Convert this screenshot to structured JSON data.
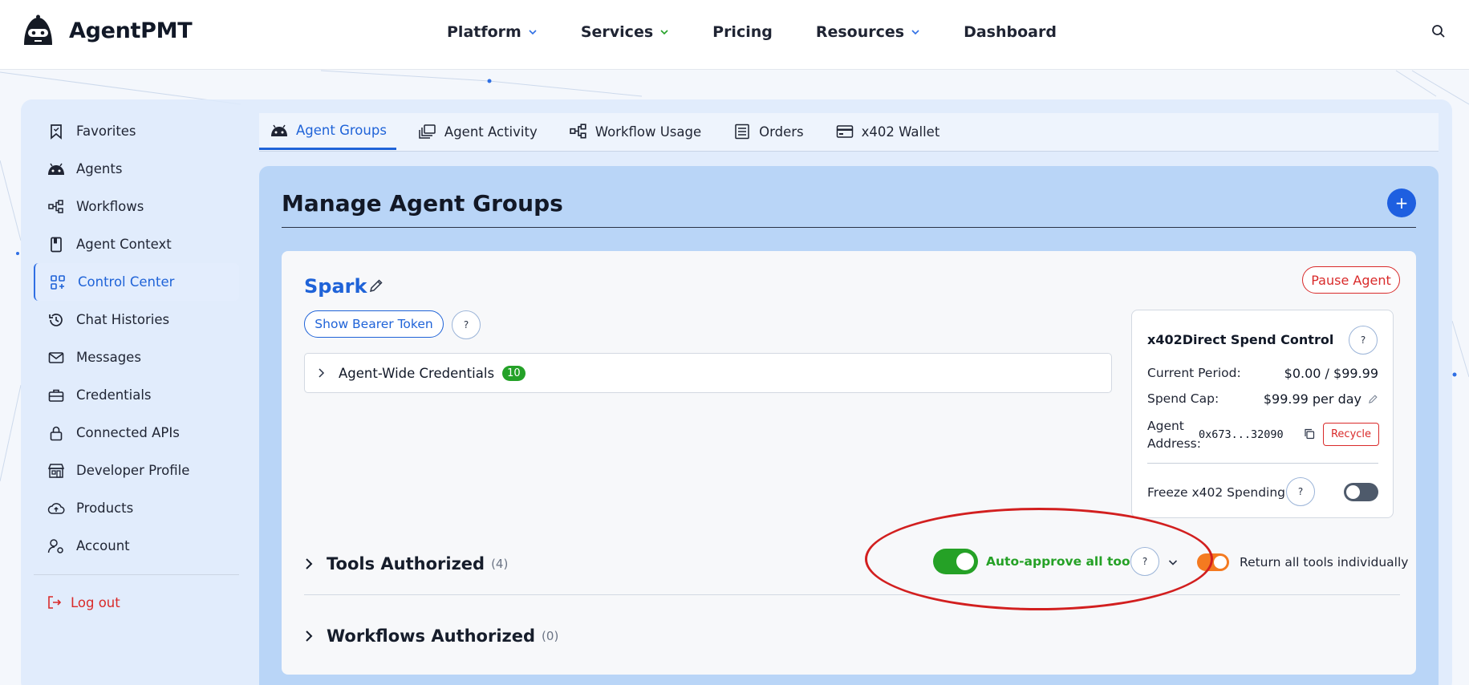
{
  "brand": {
    "name": "AgentPMT"
  },
  "nav": {
    "items": [
      {
        "label": "Platform",
        "has_dropdown": true,
        "chevron_color": "#2f6fe4"
      },
      {
        "label": "Services",
        "has_dropdown": true,
        "chevron_color": "#24a128"
      },
      {
        "label": "Pricing",
        "has_dropdown": false
      },
      {
        "label": "Resources",
        "has_dropdown": true,
        "chevron_color": "#2f6fe4"
      },
      {
        "label": "Dashboard",
        "has_dropdown": false
      }
    ],
    "search_icon": "search-icon"
  },
  "sidebar": {
    "items": [
      {
        "label": "Favorites",
        "icon": "bookmark-icon"
      },
      {
        "label": "Agents",
        "icon": "robot-icon"
      },
      {
        "label": "Workflows",
        "icon": "workflow-icon"
      },
      {
        "label": "Agent Context",
        "icon": "book-icon"
      },
      {
        "label": "Control Center",
        "icon": "grid-icon",
        "active": true
      },
      {
        "label": "Chat Histories",
        "icon": "history-icon"
      },
      {
        "label": "Messages",
        "icon": "mail-icon"
      },
      {
        "label": "Credentials",
        "icon": "briefcase-icon"
      },
      {
        "label": "Connected APIs",
        "icon": "lock-icon"
      },
      {
        "label": "Developer Profile",
        "icon": "store-icon"
      },
      {
        "label": "Products",
        "icon": "cloud-upload-icon"
      },
      {
        "label": "Account",
        "icon": "user-gear-icon"
      }
    ],
    "logout_label": "Log out"
  },
  "tabs": [
    {
      "label": "Agent Groups",
      "icon": "robot-icon",
      "active": true
    },
    {
      "label": "Agent Activity",
      "icon": "stack-icon"
    },
    {
      "label": "Workflow Usage",
      "icon": "workflow-icon"
    },
    {
      "label": "Orders",
      "icon": "receipt-icon"
    },
    {
      "label": "x402 Wallet",
      "icon": "card-icon"
    }
  ],
  "panel": {
    "title": "Manage Agent Groups",
    "add_label": "+"
  },
  "agent": {
    "name": "Spark",
    "pause_label": "Pause Agent",
    "bearer_label": "Show Bearer Token",
    "help_label": "?",
    "credentials": {
      "label": "Agent-Wide Credentials",
      "count": "10"
    }
  },
  "spend": {
    "title": "x402Direct Spend Control",
    "current_period_label": "Current Period:",
    "current_period_value": "$0.00 / $99.99",
    "cap_label": "Spend Cap:",
    "cap_value": "$99.99 per day",
    "address_label_1": "Agent",
    "address_label_2": "Address:",
    "address_value": "0x673...32090",
    "recycle_label": "Recycle",
    "freeze_label": "Freeze x402 Spending",
    "freeze_on": false
  },
  "tools": {
    "title": "Tools Authorized",
    "count": "(4)",
    "auto_label": "Auto-approve all tools",
    "auto_on": true,
    "return_label": "Return all tools individually",
    "return_on": true
  },
  "workflows": {
    "title": "Workflows Authorized",
    "count": "(0)"
  },
  "colors": {
    "primary": "#1f63d8",
    "danger": "#d92a2a",
    "success": "#24a128",
    "orange": "#f47a20"
  }
}
